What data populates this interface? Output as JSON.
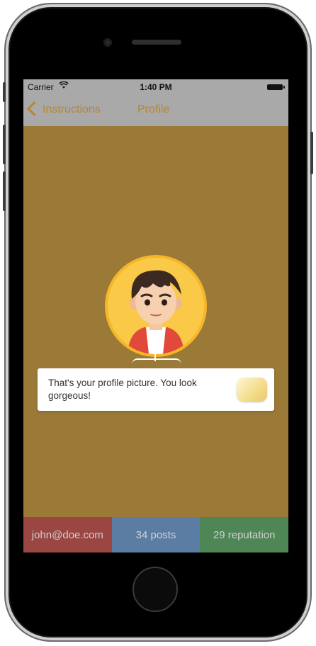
{
  "status_bar": {
    "carrier": "Carrier",
    "wifi_icon": "wifi-icon",
    "time": "1:40 PM",
    "battery_icon": "battery-icon"
  },
  "nav_bar": {
    "back_label": "Instructions",
    "back_icon": "chevron-left-icon",
    "title": "Profile",
    "tint_color": "#b8862d"
  },
  "profile": {
    "avatar_icon": "boy-avatar-icon",
    "avatar_bg_color": "#f9c947"
  },
  "tooltip": {
    "text": "That's your profile picture. You look gorgeous!",
    "chip_icon": "tooltip-badge-icon"
  },
  "stats": [
    {
      "label": "john@doe.com",
      "color": "#9a4642"
    },
    {
      "label": "34 posts",
      "color": "#5c7da3"
    },
    {
      "label": "29 reputation",
      "color": "#4e8656"
    }
  ],
  "screen_background_color": "#9b7a38"
}
